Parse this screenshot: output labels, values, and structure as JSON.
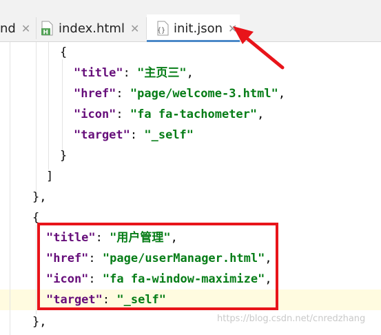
{
  "tabs": [
    {
      "label": "nd"
    },
    {
      "label": "index.html",
      "icon": "html-file-icon"
    },
    {
      "label": "init.json",
      "icon": "json-file-icon",
      "active": true
    }
  ],
  "code_lines": [
    {
      "tokens": [
        {
          "t": "p",
          "v": "{"
        }
      ]
    },
    {
      "tokens": [
        {
          "t": "k",
          "v": "\"title\""
        },
        {
          "t": "p",
          "v": ": "
        },
        {
          "t": "s",
          "v": "\"主页三\""
        },
        {
          "t": "p",
          "v": ","
        }
      ]
    },
    {
      "tokens": [
        {
          "t": "k",
          "v": "\"href\""
        },
        {
          "t": "p",
          "v": ": "
        },
        {
          "t": "s",
          "v": "\"page/welcome-3.html\""
        },
        {
          "t": "p",
          "v": ","
        }
      ]
    },
    {
      "tokens": [
        {
          "t": "k",
          "v": "\"icon\""
        },
        {
          "t": "p",
          "v": ": "
        },
        {
          "t": "s",
          "v": "\"fa fa-tachometer\""
        },
        {
          "t": "p",
          "v": ","
        }
      ]
    },
    {
      "tokens": [
        {
          "t": "k",
          "v": "\"target\""
        },
        {
          "t": "p",
          "v": ": "
        },
        {
          "t": "s",
          "v": "\"_self\""
        }
      ]
    },
    {
      "tokens": [
        {
          "t": "p",
          "v": "}"
        }
      ]
    },
    {
      "tokens": [
        {
          "t": "p",
          "v": "]"
        }
      ]
    },
    {
      "tokens": [
        {
          "t": "p",
          "v": "},"
        }
      ]
    },
    {
      "tokens": [
        {
          "t": "p",
          "v": "{"
        }
      ]
    },
    {
      "tokens": [
        {
          "t": "k",
          "v": "\"title\""
        },
        {
          "t": "p",
          "v": ": "
        },
        {
          "t": "s",
          "v": "\"用户管理\""
        },
        {
          "t": "p",
          "v": ","
        }
      ]
    },
    {
      "tokens": [
        {
          "t": "k",
          "v": "\"href\""
        },
        {
          "t": "p",
          "v": ": "
        },
        {
          "t": "s",
          "v": "\"page/userManager.html\""
        },
        {
          "t": "p",
          "v": ","
        }
      ]
    },
    {
      "tokens": [
        {
          "t": "k",
          "v": "\"icon\""
        },
        {
          "t": "p",
          "v": ": "
        },
        {
          "t": "s",
          "v": "\"fa fa-window-maximize\""
        },
        {
          "t": "p",
          "v": ","
        }
      ]
    },
    {
      "tokens": [
        {
          "t": "k",
          "v": "\"target\""
        },
        {
          "t": "p",
          "v": ": "
        },
        {
          "t": "s",
          "v": "\"_self\""
        }
      ]
    },
    {
      "tokens": [
        {
          "t": "p",
          "v": "},"
        }
      ]
    }
  ],
  "watermark": "https://blog.csdn.net/cnredzhang",
  "colors": {
    "key": "#660e7a",
    "string": "#067d17",
    "highlight_box": "#e8141a",
    "tab_underline": "#4a88c7"
  }
}
